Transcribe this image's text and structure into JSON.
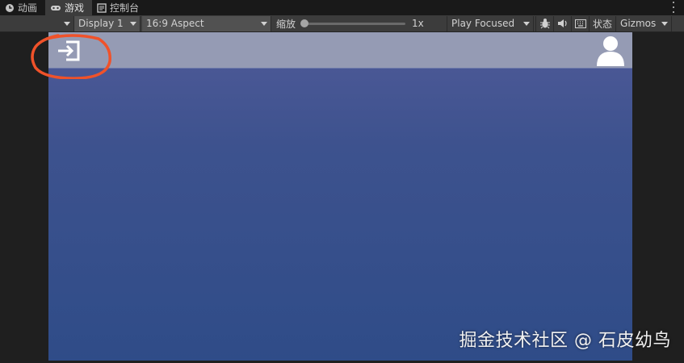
{
  "tabs": [
    {
      "label": "动画",
      "icon": "clock-icon",
      "active": false
    },
    {
      "label": "游戏",
      "icon": "gamepad-icon",
      "active": true
    },
    {
      "label": "控制台",
      "icon": "console-icon",
      "active": false
    }
  ],
  "toolbar": {
    "game_dropdown": "",
    "display": "Display 1",
    "aspect": "16:9 Aspect",
    "zoom_label": "缩放",
    "zoom_value": "1x",
    "play_mode": "Play Focused",
    "stats_label": "状态",
    "gizmos_label": "Gizmos"
  },
  "game": {
    "header_color": "#959bb4",
    "background_top": "#4f5a98",
    "background_bottom": "#2f4c88",
    "login_icon": "login-icon",
    "avatar_icon": "user-avatar-icon"
  },
  "annotation": {
    "color": "#f0522a"
  },
  "watermark": "掘金技术社区 @ 石皮幼鸟"
}
